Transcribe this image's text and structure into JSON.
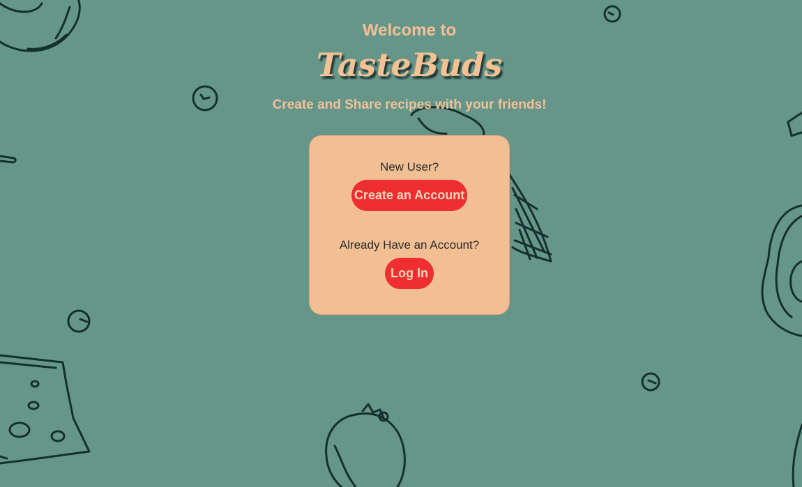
{
  "hero": {
    "welcome": "Welcome to",
    "brand": "TasteBuds",
    "tagline": "Create and Share recipes with your friends!"
  },
  "card": {
    "new_user_prompt": "New User?",
    "create_account_label": "Create an Account",
    "existing_user_prompt": "Already Have an Account?",
    "login_label": "Log In"
  },
  "colors": {
    "background": "#66958a",
    "accent_text": "#f4c195",
    "card": "#f2bf94",
    "button": "#ee2e31",
    "doodle_stroke": "#14302c"
  },
  "background_icons": [
    "bagel-icon",
    "pea-icon",
    "carrot-icon",
    "avocado-icon",
    "cheese-icon",
    "tomato-icon"
  ]
}
